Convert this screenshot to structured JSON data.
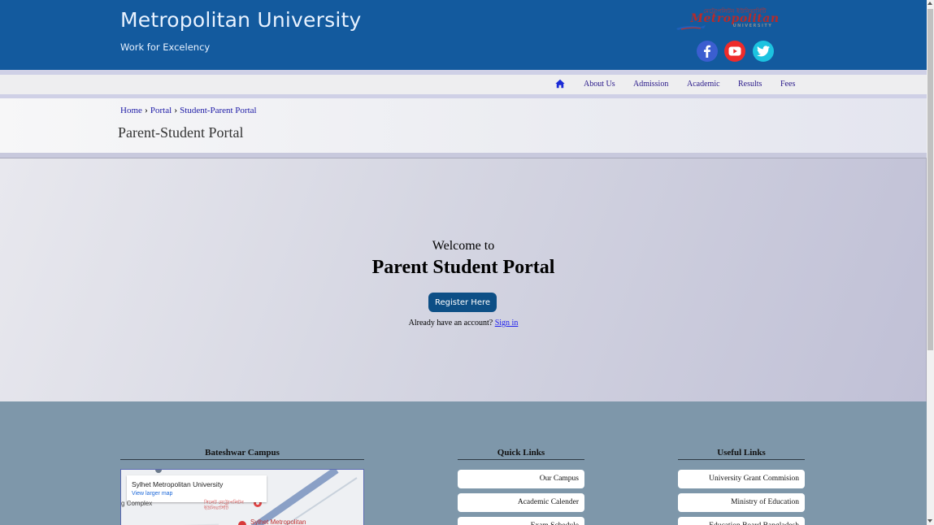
{
  "header": {
    "title": "Metropolitan University",
    "tagline": "Work for Excelency",
    "logo": {
      "bangla_text": "মেট্রোপলিটন ইউনিভার্সিটি",
      "main_text": "Metropolitan",
      "sub_text": "UNIVERSITY"
    },
    "social": [
      {
        "name": "facebook",
        "icon": "facebook-icon",
        "color": "#3b5ed0"
      },
      {
        "name": "youtube",
        "icon": "youtube-icon",
        "color": "#ee2b2b"
      },
      {
        "name": "twitter",
        "icon": "twitter-icon",
        "color": "#1cc3e0"
      }
    ],
    "colors": {
      "background": "#135a9e"
    }
  },
  "nav": {
    "home_icon": "home-icon",
    "items": [
      {
        "label": "About Us"
      },
      {
        "label": "Admission"
      },
      {
        "label": "Academic"
      },
      {
        "label": "Results"
      },
      {
        "label": "Fees"
      }
    ]
  },
  "breadcrumb": {
    "items": [
      "Home",
      "Portal",
      "Student-Parent Portal"
    ],
    "separator_icon": "chevron-right-icon"
  },
  "page_title": "Parent-Student Portal",
  "hero": {
    "welcome": "Welcome to",
    "heading": "Parent Student Portal",
    "register_label": "Register Here",
    "account_prompt": "Already have an account?",
    "signin_label": "Sign in",
    "colors": {
      "button": "#0d4f86",
      "link": "#2222ee"
    }
  },
  "footer": {
    "background": "#7e97aa",
    "campus": {
      "heading": "Bateshwar Campus",
      "map": {
        "place_name": "Sylhet Metropolitan University",
        "view_link": "View larger map",
        "labels": [
          "g Complex",
          "Sylhet Metropolitan"
        ]
      }
    },
    "quick_links": {
      "heading": "Quick Links",
      "items": [
        "Our Campus",
        "Academic Calender",
        "Exam Schedule"
      ]
    },
    "useful_links": {
      "heading": "Useful Links",
      "items": [
        "University Grant Commision",
        "Ministry of Education",
        "Education Board Bangladesh"
      ]
    }
  }
}
